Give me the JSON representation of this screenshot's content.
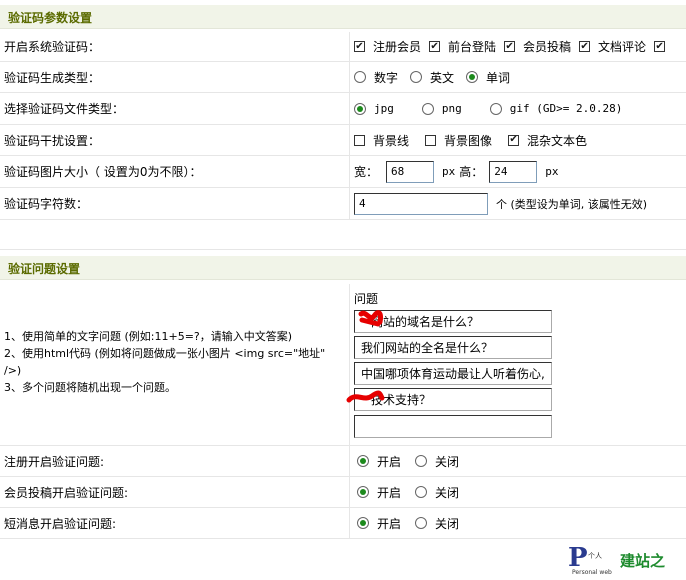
{
  "captcha_section": {
    "title": "验证码参数设置",
    "rows": {
      "enable": {
        "label": "开启系统验证码：",
        "options": [
          "注册会员",
          "前台登陆",
          "会员投稿",
          "文档评论"
        ]
      },
      "gen_type": {
        "label": "验证码生成类型：",
        "options": [
          "数字",
          "英文",
          "单词"
        ],
        "selected": "单词"
      },
      "file_type": {
        "label": "选择验证码文件类型：",
        "options": [
          "jpg",
          "png",
          "gif (GD>= 2.0.28)"
        ],
        "selected": "jpg"
      },
      "interference": {
        "label": "验证码干扰设置：",
        "options": [
          "背景线",
          "背景图像",
          "混杂文本色"
        ],
        "checked": [
          "混杂文本色"
        ]
      },
      "size": {
        "label": "验证码图片大小（ 设置为0为不限）：",
        "width_label": "宽：",
        "width_value": "68",
        "unit": "px",
        "height_label": "高：",
        "height_value": "24"
      },
      "chars": {
        "label": "验证码字符数：",
        "value": "4",
        "note": "个 (类型设为单词, 该属性无效)"
      }
    }
  },
  "question_section": {
    "title": "验证问题设置",
    "help_lines": [
      "1、使用简单的文字问题 (例如:11+5=?，请输入中文答案)",
      "2、使用html代码 (例如将问题做成一张小图片 <img src=\"地址\"",
      "/>)",
      "3、多个问题将随机出现一个问题。"
    ],
    "question_header": "问题",
    "questions": [
      "网站的域名是什么？",
      "我们网站的全名是什么？",
      "中国哪项体育运动最让人听着伤心,",
      "技术支持？",
      ""
    ],
    "toggles": [
      {
        "label": "注册开启验证问题:",
        "on": "开启",
        "off": "关闭",
        "selected": "开启"
      },
      {
        "label": "会员投稿开启验证问题:",
        "on": "开启",
        "off": "关闭",
        "selected": "开启"
      },
      {
        "label": "短消息开启验证问题:",
        "on": "开启",
        "off": "关闭",
        "selected": "开启"
      }
    ]
  },
  "footer": {
    "logo_letter": "P",
    "logo_small_top": "个人",
    "logo_small_bottom": "Personal web",
    "logo_text": "建站之"
  },
  "colors": {
    "section_bg": "#f1f4e8",
    "section_title": "#5b6b00",
    "radio_dot": "#1d8a1d",
    "scribble": "#e60000"
  }
}
